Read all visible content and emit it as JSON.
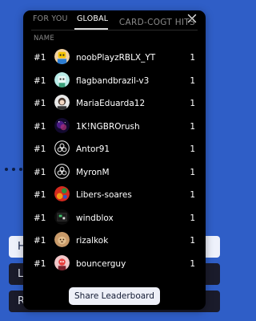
{
  "tabs": [
    {
      "label": "FOR YOU",
      "active": false
    },
    {
      "label": "GLOBAL",
      "active": true
    }
  ],
  "columns": {
    "name": "NAME",
    "hits": "CARD-COGT HITS"
  },
  "rows": [
    {
      "rank": "#1",
      "username": "noobPlayzRBLX_YT",
      "hits": "1",
      "avatar": "roblox-avatar"
    },
    {
      "rank": "#1",
      "username": "flagbandbrazil-v3",
      "hits": "1",
      "avatar": "roblox-avatar"
    },
    {
      "rank": "#1",
      "username": "MariaEduarda12",
      "hits": "1",
      "avatar": "person-avatar"
    },
    {
      "rank": "#1",
      "username": "1K!NGBROrush",
      "hits": "1",
      "avatar": "galaxy-avatar"
    },
    {
      "rank": "#1",
      "username": "Antor91",
      "hits": "1",
      "avatar": "biohazard-avatar"
    },
    {
      "rank": "#1",
      "username": "MyronM",
      "hits": "1",
      "avatar": "biohazard-avatar"
    },
    {
      "rank": "#1",
      "username": "Libers-soares",
      "hits": "1",
      "avatar": "color-avatar"
    },
    {
      "rank": "#1",
      "username": "windblox",
      "hits": "1",
      "avatar": "game-avatar"
    },
    {
      "rank": "#1",
      "username": "rizalkok",
      "hits": "1",
      "avatar": "animal-avatar"
    },
    {
      "rank": "#1",
      "username": "bouncerguy",
      "hits": "1",
      "avatar": "character-avatar"
    }
  ],
  "share_label": "Share Leaderboard",
  "background_buttons": [
    "H",
    "L",
    "R"
  ],
  "colors": {
    "page_bg": "#2f5ec7",
    "modal_bg": "#000000",
    "button_bg": "#eef0f8"
  }
}
